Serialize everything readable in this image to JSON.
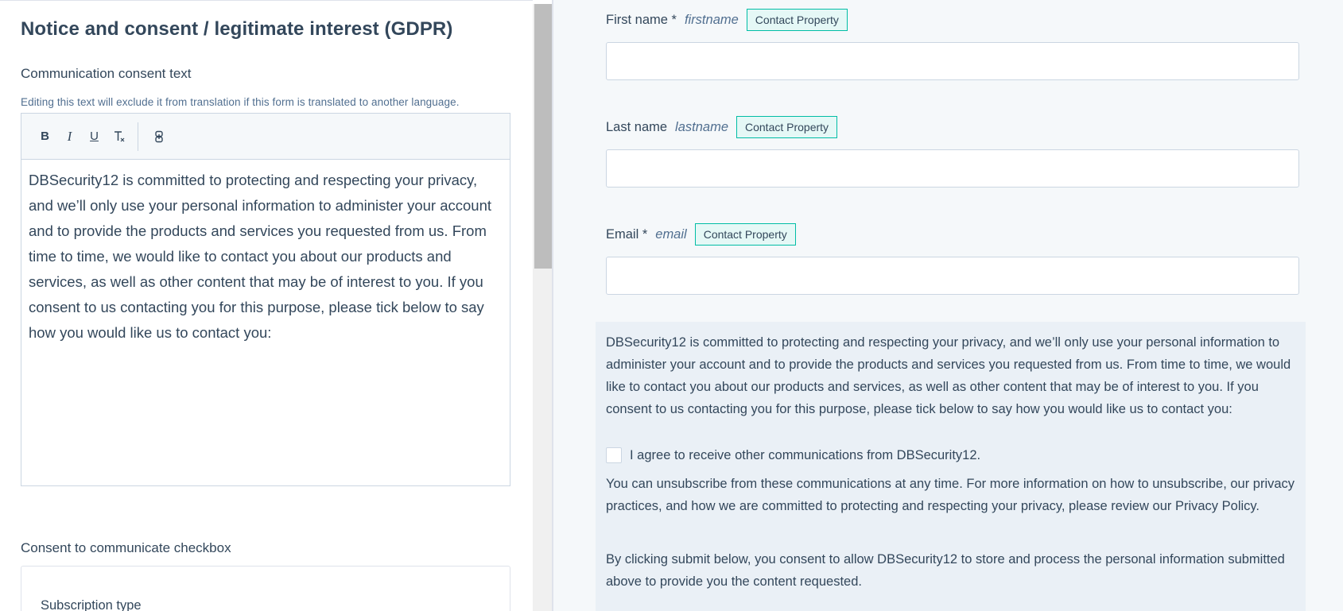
{
  "left": {
    "title": "Notice and consent / legitimate interest (GDPR)",
    "consent_text_label": "Communication consent text",
    "help_text": "Editing this text will exclude it from translation if this form is translated to another language.",
    "toolbar": {
      "bold": "B",
      "italic": "I",
      "underline": "U",
      "clear_format": "Tx",
      "link": "⛓"
    },
    "editor_text": "DBSecurity12 is committed to protecting and respecting your privacy, and we’ll only use your personal information to administer your account and to provide the products and services you requested from us. From time to time, we would like to contact you about our products and services, as well as other content that may be of interest to you. If you consent to us contacting you for this purpose, please tick below to say how you would like us to contact you:",
    "checkbox_section_label": "Consent to communicate checkbox",
    "subscription_type_label": "Subscription type"
  },
  "form": {
    "fields": [
      {
        "label": "First name *",
        "name": "firstname",
        "badge": "Contact Property"
      },
      {
        "label": "Last name",
        "name": "lastname",
        "badge": "Contact Property"
      },
      {
        "label": "Email *",
        "name": "email",
        "badge": "Contact Property"
      }
    ],
    "consent_text": "DBSecurity12 is committed to protecting and respecting your privacy, and we’ll only use your personal information to administer your account and to provide the products and services you requested from us. From time to time, we would like to contact you about our products and services, as well as other content that may be of interest to you. If you consent to us contacting you for this purpose, please tick below to say how you would like us to contact you:",
    "checkbox_label": "I agree to receive other communications from DBSecurity12.",
    "unsubscribe_text": "You can unsubscribe from these communications at any time. For more information on how to unsubscribe, our privacy practices, and how we are committed to protecting and respecting your privacy, please review our Privacy Policy.",
    "submit_consent_text": "By clicking submit below, you consent to allow DBSecurity12 to store and process the personal information submitted above to provide you the content requested."
  },
  "colors": {
    "text": "#33475b",
    "badge_border": "#00bda5",
    "panel_bg": "#f5f8fa",
    "consent_bg": "#eaf0f6"
  }
}
